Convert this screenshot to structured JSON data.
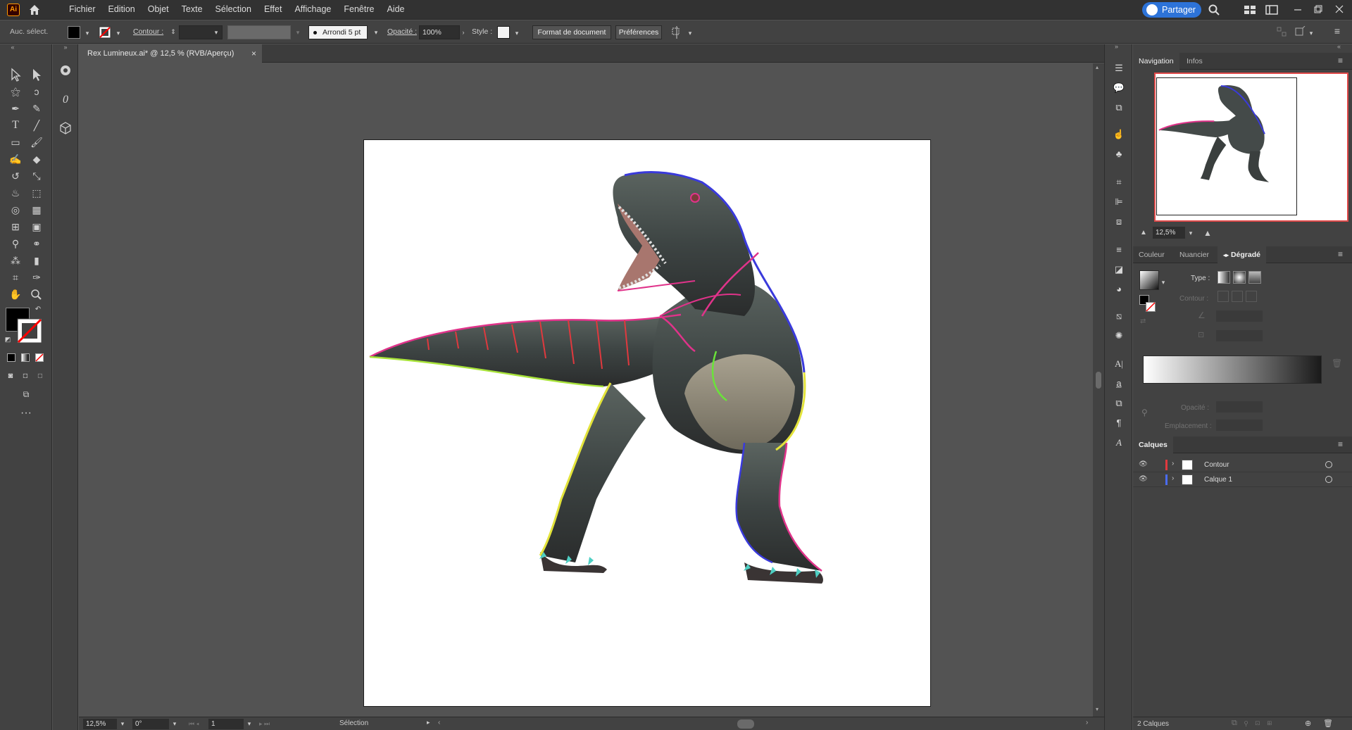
{
  "app": {
    "logo": "Ai",
    "menu": [
      "Fichier",
      "Edition",
      "Objet",
      "Texte",
      "Sélection",
      "Effet",
      "Affichage",
      "Fenêtre",
      "Aide"
    ],
    "share_label": "Partager"
  },
  "control_bar": {
    "selection_status": "Auc. sélect.",
    "stroke_label": "Contour :",
    "brush_label": "Arrondi 5 pt",
    "opacity_label": "Opacité :",
    "opacity_value": "100%",
    "style_label": "Style :",
    "doc_format_button": "Format de document",
    "preferences_button": "Préférences"
  },
  "document": {
    "tab_title": "Rex Lumineux.ai* @ 12,5 % (RVB/Aperçu)",
    "close": "×"
  },
  "status_bar": {
    "zoom": "12,5%",
    "rotation": "0°",
    "artboard": "1",
    "tool": "Sélection"
  },
  "navigation": {
    "tabs": [
      "Navigation",
      "Infos"
    ],
    "zoom": "12,5%"
  },
  "gradient_panel": {
    "tabs": [
      "Couleur",
      "Nuancier",
      "Dégradé"
    ],
    "type_label": "Type :",
    "stroke_label": "Contour :",
    "opacity_label": "Opacité :",
    "location_label": "Emplacement :"
  },
  "layers": {
    "title": "Calques",
    "items": [
      {
        "name": "Contour",
        "color": "#e0393e"
      },
      {
        "name": "Calque 1",
        "color": "#4a6cf0"
      }
    ],
    "count": "2 Calques"
  },
  "colors": {
    "accent": "#2d73d8",
    "fill": "#000000",
    "stroke_none": "#ff0000"
  }
}
